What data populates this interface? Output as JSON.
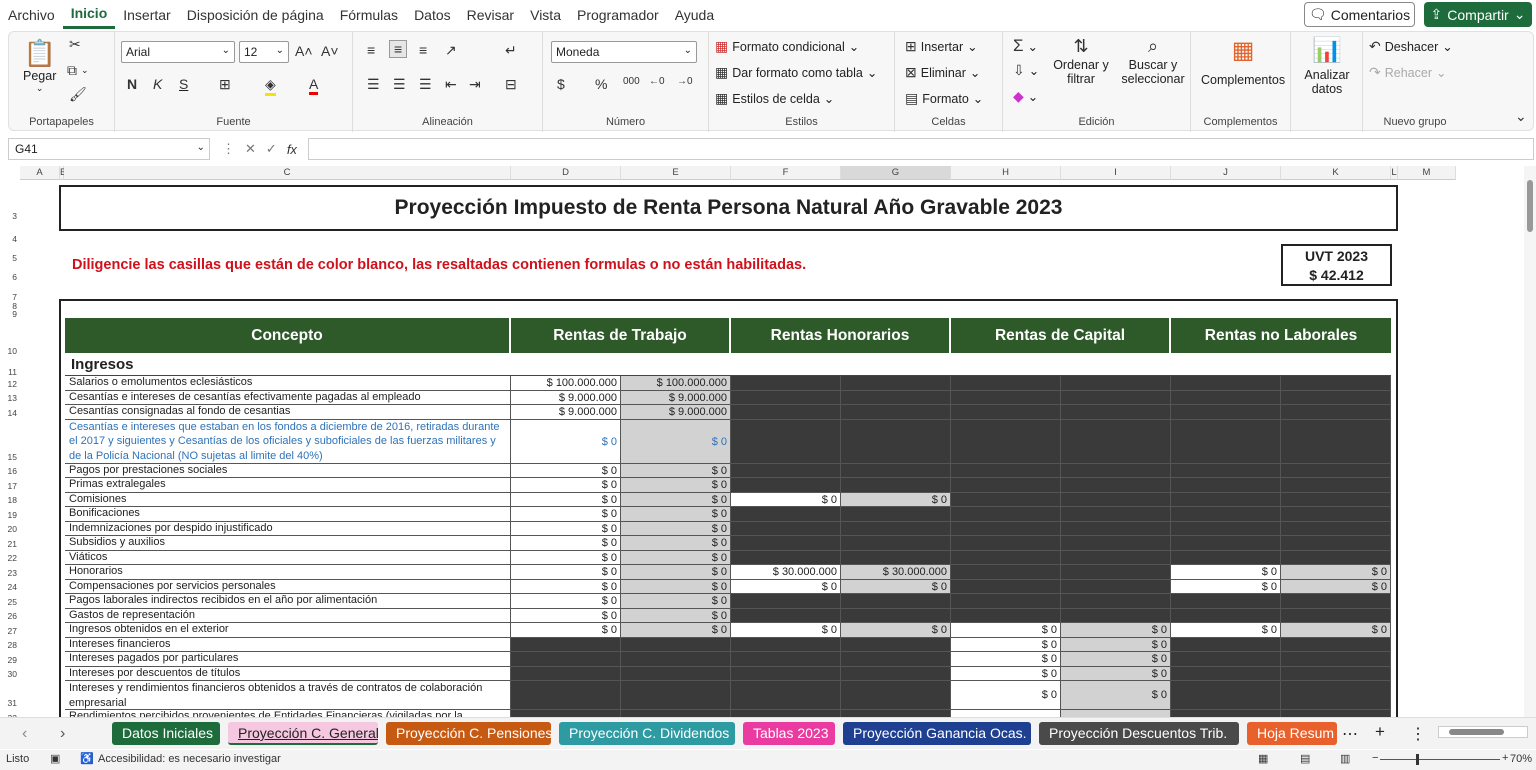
{
  "menu": {
    "items": [
      "Archivo",
      "Inicio",
      "Insertar",
      "Disposición de página",
      "Fórmulas",
      "Datos",
      "Revisar",
      "Vista",
      "Programador",
      "Ayuda"
    ],
    "active": "Inicio",
    "comments": "Comentarios",
    "share": "Compartir"
  },
  "ribbon": {
    "portapapeles": {
      "label": "Portapapeles",
      "paste": "Pegar"
    },
    "fuente": {
      "label": "Fuente",
      "font": "Arial",
      "size": "12"
    },
    "alineacion": {
      "label": "Alineación"
    },
    "numero": {
      "label": "Número",
      "format": "Moneda"
    },
    "estilos": {
      "label": "Estilos",
      "cond": "Formato condicional",
      "table": "Dar formato como tabla",
      "cell": "Estilos de celda"
    },
    "celdas": {
      "label": "Celdas",
      "insert": "Insertar",
      "delete": "Eliminar",
      "format": "Formato"
    },
    "edicion": {
      "label": "Edición",
      "sort": "Ordenar y filtrar",
      "find": "Buscar y seleccionar"
    },
    "complementos": {
      "label": "Complementos",
      "btn": "Complementos"
    },
    "analizar": {
      "btn": "Analizar datos"
    },
    "nuevo": {
      "label": "Nuevo grupo",
      "undo": "Deshacer",
      "redo": "Rehacer"
    }
  },
  "formula": {
    "cell": "G41",
    "content": ""
  },
  "sheet": {
    "title": "Proyección Impuesto de Renta Persona Natural Año Gravable 2023",
    "instruction": "Diligencie las casillas que están de color blanco, las resaltadas contienen formulas o no están habilitadas.",
    "uvt_label": "UVT 2023",
    "uvt_value": "$ 42.412",
    "headers": [
      "Concepto",
      "Rentas de Trabajo",
      "Rentas Honorarios",
      "Rentas de Capital",
      "Rentas no Laborales"
    ],
    "section": "Ingresos",
    "columns": [
      "A",
      "B",
      "C",
      "D",
      "E",
      "F",
      "G",
      "H",
      "I",
      "J",
      "K",
      "L",
      "M"
    ],
    "rows": [
      {
        "n": "12",
        "label": "Salarios o emolumentos eclesiásticos",
        "v": [
          "$ 100.000.000",
          "$ 100.000.000",
          "",
          "",
          "",
          "",
          "",
          ""
        ],
        "s": "wgddddddd"
      },
      {
        "n": "13",
        "label": "Cesantías e intereses de cesantías efectivamente pagadas al empleado",
        "v": [
          "$ 9.000.000",
          "$ 9.000.000",
          "",
          "",
          "",
          "",
          "",
          ""
        ],
        "s": "wgdddddd"
      },
      {
        "n": "14",
        "label": "Cesantías consignadas al fondo de cesantias",
        "v": [
          "$ 9.000.000",
          "$ 9.000.000",
          "",
          "",
          "",
          "",
          "",
          ""
        ],
        "s": "wgdddddd"
      },
      {
        "n": "15",
        "label": "Cesantías e intereses que estaban en los fondos a diciembre de 2016, retiradas durante el 2017 y siguientes y Cesantías de los oficiales y suboficiales de las fuerzas militares y de la Policía Nacional (NO sujetas al limite del 40%)",
        "v": [
          "$ 0",
          "$ 0",
          "",
          "",
          "",
          "",
          "",
          ""
        ],
        "s": "wgdddddd",
        "tall": true,
        "blue": true
      },
      {
        "n": "16",
        "label": "Pagos por prestaciones sociales",
        "v": [
          "$ 0",
          "$ 0",
          "",
          "",
          "",
          "",
          "",
          ""
        ],
        "s": "wgdddddd"
      },
      {
        "n": "17",
        "label": "Primas extralegales",
        "v": [
          "$ 0",
          "$ 0",
          "",
          "",
          "",
          "",
          "",
          ""
        ],
        "s": "wgdddddd"
      },
      {
        "n": "18",
        "label": "Comisiones",
        "v": [
          "$ 0",
          "$ 0",
          "$ 0",
          "$ 0",
          "",
          "",
          "",
          ""
        ],
        "s": "wgwgdddd"
      },
      {
        "n": "19",
        "label": "Bonificaciones",
        "v": [
          "$ 0",
          "$ 0",
          "",
          "",
          "",
          "",
          "",
          ""
        ],
        "s": "wgdddddd"
      },
      {
        "n": "20",
        "label": "Indemnizaciones por despido injustificado",
        "v": [
          "$ 0",
          "$ 0",
          "",
          "",
          "",
          "",
          "",
          ""
        ],
        "s": "wgdddddd"
      },
      {
        "n": "21",
        "label": "Subsidios y auxilios",
        "v": [
          "$ 0",
          "$ 0",
          "",
          "",
          "",
          "",
          "",
          ""
        ],
        "s": "wgdddddd"
      },
      {
        "n": "22",
        "label": "Viáticos",
        "v": [
          "$ 0",
          "$ 0",
          "",
          "",
          "",
          "",
          "",
          ""
        ],
        "s": "wgdddddd"
      },
      {
        "n": "23",
        "label": "Honorarios",
        "v": [
          "$ 0",
          "$ 0",
          "$ 30.000.000",
          "$ 30.000.000",
          "",
          "",
          "$ 0",
          "$ 0"
        ],
        "s": "wgwgddwg"
      },
      {
        "n": "24",
        "label": "Compensaciones por servicios personales",
        "v": [
          "$ 0",
          "$ 0",
          "$ 0",
          "$ 0",
          "",
          "",
          "$ 0",
          "$ 0"
        ],
        "s": "wgwgddwg"
      },
      {
        "n": "25",
        "label": "Pagos laborales indirectos recibidos en el año por alimentación",
        "v": [
          "$ 0",
          "$ 0",
          "",
          "",
          "",
          "",
          "",
          ""
        ],
        "s": "wgdddddd"
      },
      {
        "n": "26",
        "label": "Gastos de representación",
        "v": [
          "$ 0",
          "$ 0",
          "",
          "",
          "",
          "",
          "",
          ""
        ],
        "s": "wgdddddd"
      },
      {
        "n": "27",
        "label": "Ingresos obtenidos en el exterior",
        "v": [
          "$ 0",
          "$ 0",
          "$ 0",
          "$ 0",
          "$ 0",
          "$ 0",
          "$ 0",
          "$ 0"
        ],
        "s": "wgwgwgwg"
      },
      {
        "n": "28",
        "label": "Intereses financieros",
        "v": [
          "",
          "",
          "",
          "",
          "$ 0",
          "$ 0",
          "",
          ""
        ],
        "s": "ddddwgdd"
      },
      {
        "n": "29",
        "label": "Intereses pagados por particulares",
        "v": [
          "",
          "",
          "",
          "",
          "$ 0",
          "$ 0",
          "",
          ""
        ],
        "s": "ddddwgdd"
      },
      {
        "n": "30",
        "label": "Intereses por descuentos de títulos",
        "v": [
          "",
          "",
          "",
          "",
          "$ 0",
          "$ 0",
          "",
          ""
        ],
        "s": "ddddwgdd"
      },
      {
        "n": "31",
        "label": "Intereses y rendimientos financieros obtenidos a través de contratos de colaboración empresarial",
        "v": [
          "",
          "",
          "",
          "",
          "$ 0",
          "$ 0",
          "",
          ""
        ],
        "s": "ddddwgdd",
        "tall2": true
      },
      {
        "n": "32",
        "label": "Rendimientos percibidos provenientes de Entidades Financieras (vigiladas por la",
        "v": [
          "",
          "",
          "",
          "",
          "",
          "",
          "",
          ""
        ],
        "s": "ddddwgdd"
      }
    ]
  },
  "tabs": [
    {
      "label": "Datos Iniciales",
      "color": "#1e6b3b"
    },
    {
      "label": "Proyección C. General",
      "color": "#f6c7e0",
      "active": true
    },
    {
      "label": "Proyección C. Pensiones",
      "color": "#c65a12"
    },
    {
      "label": "Proyección C. Dividendos",
      "color": "#2e9ba3"
    },
    {
      "label": "Tablas 2023",
      "color": "#e93ba0"
    },
    {
      "label": "Proyección Ganancia Ocas.",
      "color": "#1f3f91"
    },
    {
      "label": "Proyección Descuentos Trib.",
      "color": "#4a4a4a"
    },
    {
      "label": "Hoja Resum",
      "color": "#e8612c"
    }
  ],
  "status": {
    "ready": "Listo",
    "accessibility": "Accesibilidad: es necesario investigar",
    "zoom": "70%"
  }
}
